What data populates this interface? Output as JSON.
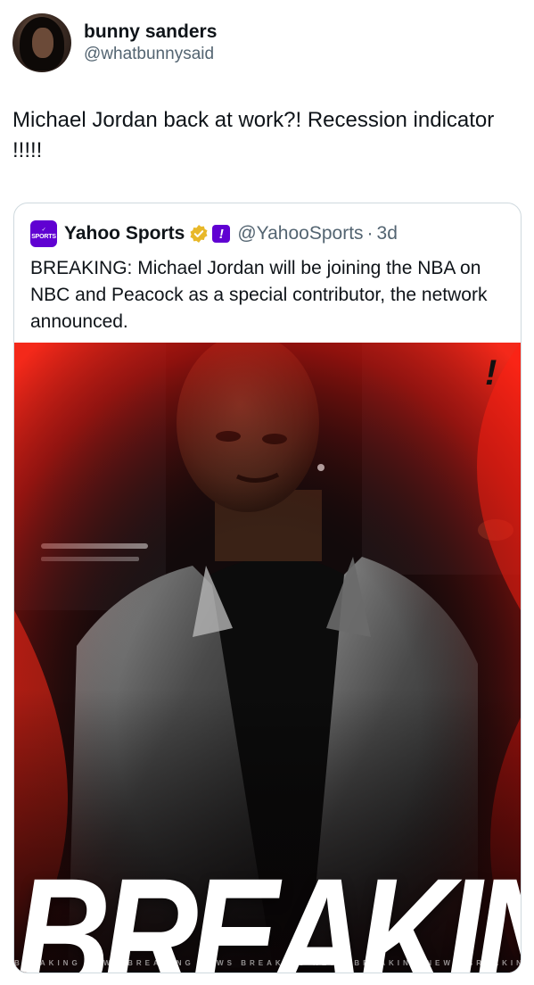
{
  "tweet": {
    "display_name": "bunny sanders",
    "handle": "@whatbunnysaid",
    "text": "Michael Jordan back at work?! Recession indicator !!!!!"
  },
  "quoted": {
    "logo_text": "SPORTS",
    "display_name": "Yahoo Sports",
    "affiliate_badge": "!",
    "handle": "@YahooSports",
    "separator": "·",
    "time": "3d",
    "text": "BREAKING: Michael Jordan will be joining the NBA on NBC and Peacock as a special contributor, the network announced.",
    "image": {
      "headline": "BREAKING",
      "ticker": "BREAKING NEWS BREAKING NEWS BREAKING NEWS BREAKING NEWS BREAKING NEWS BREAKING NEWS",
      "corner_mark": "!",
      "accent_color": "#e41b13"
    }
  },
  "colors": {
    "verified": "#e8b829",
    "brand": "#6001d2",
    "muted": "#536471"
  }
}
